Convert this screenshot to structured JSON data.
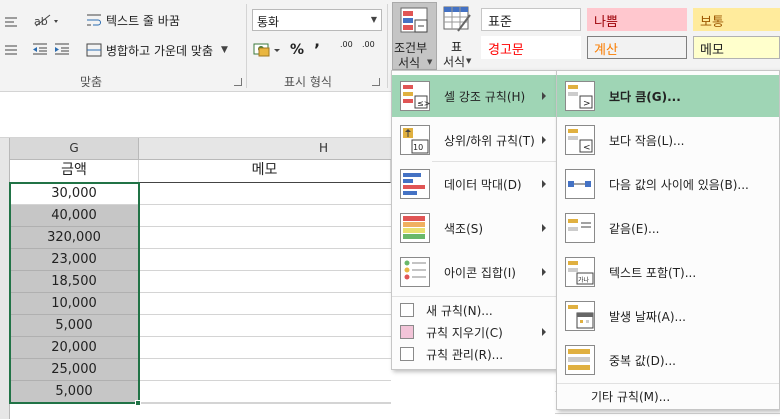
{
  "ribbon": {
    "wrap_text": "텍스트 줄 바꿈",
    "merge_center": "병합하고 가운데 맞춤",
    "alignment_group": "맞춤",
    "number_format": "통화",
    "percent": "%",
    "comma": "’",
    "dec_inc": ".00",
    "dec_dec": ".00",
    "number_group": "표시 형식",
    "cond_format_line1": "조건부",
    "cond_format_line2": "서식",
    "table_line1": "표",
    "table_line2": "서식",
    "styles": [
      {
        "label": "표준",
        "bg": "#ffffff",
        "fg": "#222222",
        "border": "#c6c6c6"
      },
      {
        "label": "나쁨",
        "bg": "#ffc7ce",
        "fg": "#9c0006",
        "border": "#ffc7ce"
      },
      {
        "label": "보통",
        "bg": "#ffeb9c",
        "fg": "#9c5700",
        "border": "#ffeb9c"
      },
      {
        "label": "경고문",
        "bg": "#ffffff",
        "fg": "#ff0000",
        "border": "#ffffff"
      },
      {
        "label": "계산",
        "bg": "#f2f2f2",
        "fg": "#fa7d00",
        "border": "#7f7f7f"
      },
      {
        "label": "메모",
        "bg": "#ffffcc",
        "fg": "#222222",
        "border": "#b2b2b2"
      }
    ]
  },
  "sheet": {
    "col_g": "G",
    "col_h": "H",
    "header_g": "금액",
    "header_h": "메모",
    "amounts": [
      "30,000",
      "40,000",
      "320,000",
      "23,000",
      "18,500",
      "10,000",
      "5,000",
      "20,000",
      "25,000",
      "5,000"
    ]
  },
  "menu": {
    "items": [
      {
        "label": "셀 강조 규칙(H)"
      },
      {
        "label": "상위/하위 규칙(T)"
      },
      {
        "label": "데이터 막대(D)"
      },
      {
        "label": "색조(S)"
      },
      {
        "label": "아이콘 집합(I)"
      }
    ],
    "small_items": [
      {
        "label": "새 규칙(N)..."
      },
      {
        "label": "규칙 지우기(C)"
      },
      {
        "label": "규칙 관리(R)..."
      }
    ],
    "top_icon_number": "10"
  },
  "submenu": {
    "items": [
      {
        "label": "보다 큼(G)..."
      },
      {
        "label": "보다 작음(L)..."
      },
      {
        "label": "다음 값의 사이에 있음(B)..."
      },
      {
        "label": "같음(E)..."
      },
      {
        "label": "텍스트 포함(T)..."
      },
      {
        "label": "발생 날짜(A)..."
      },
      {
        "label": "중복 값(D)..."
      }
    ],
    "more": "기타 규칙(M)...",
    "text_icon": "가나"
  },
  "colors": {
    "highlight": "#9fd5b5",
    "selection_border": "#217346"
  }
}
